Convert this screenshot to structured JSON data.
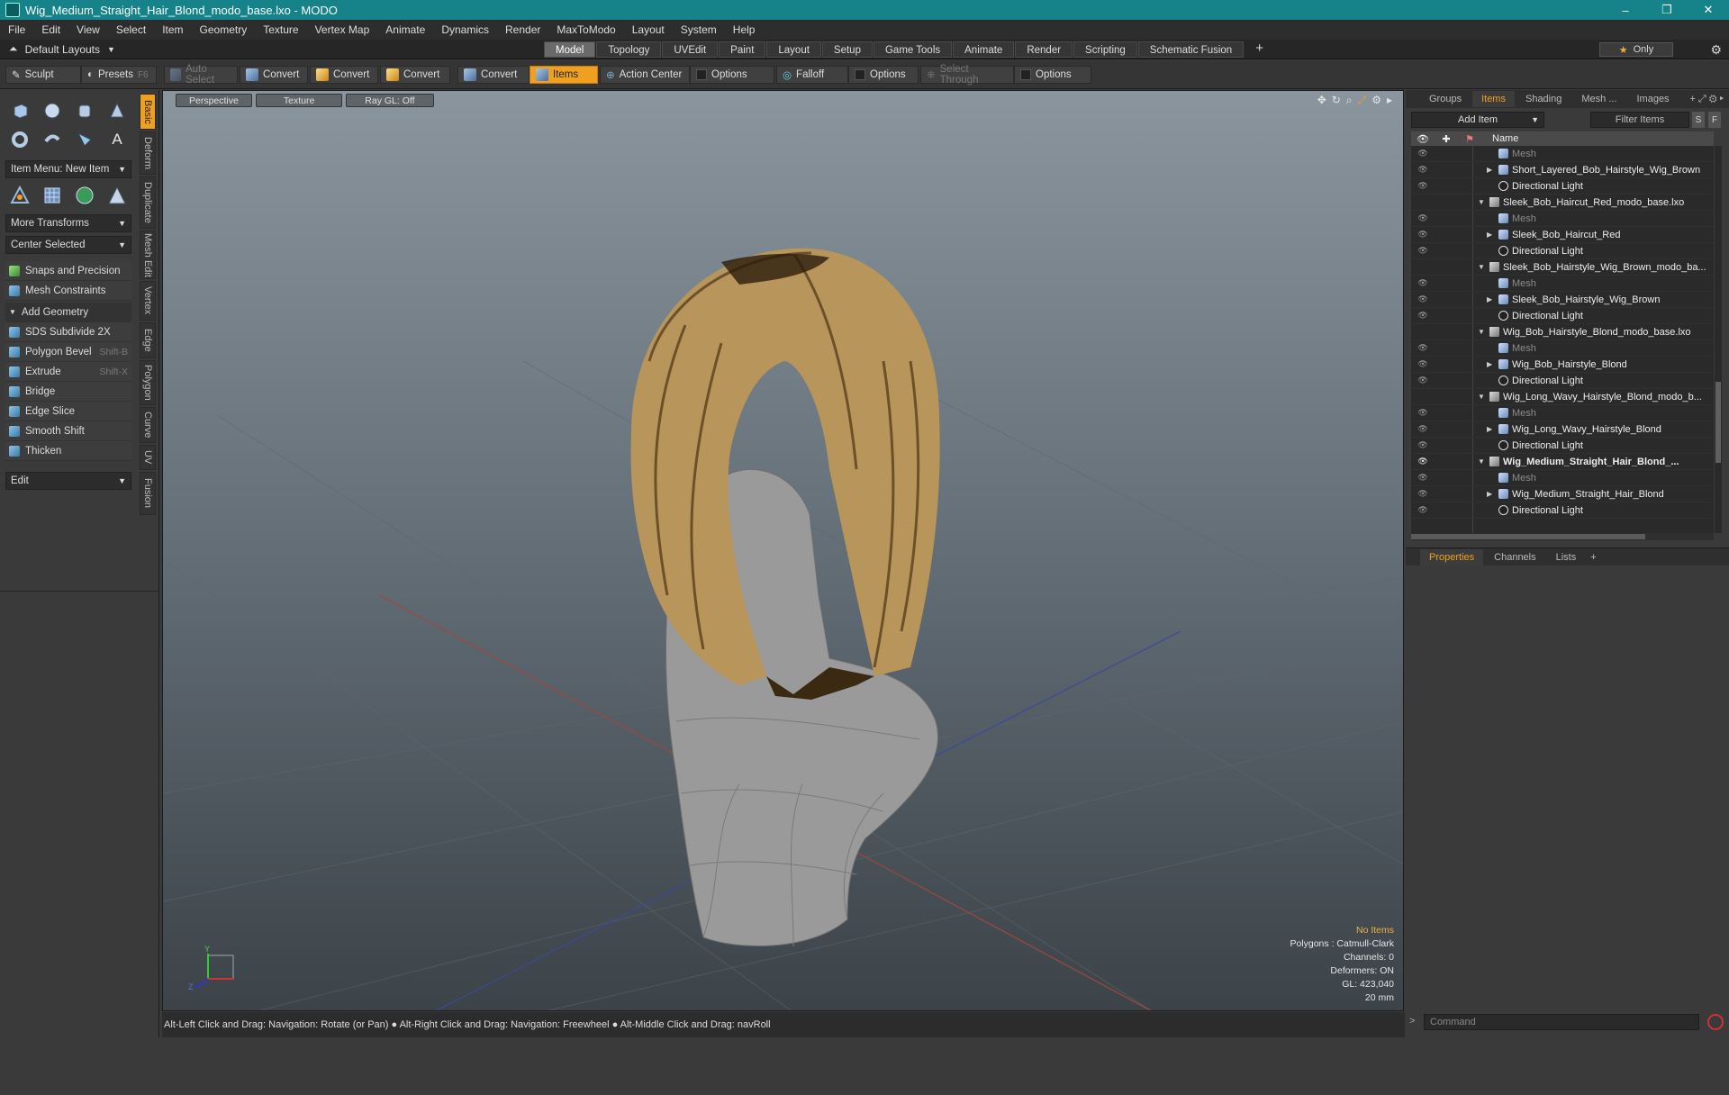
{
  "window": {
    "title": "Wig_Medium_Straight_Hair_Blond_modo_base.lxo - MODO",
    "controls": [
      "–",
      "❐",
      "✕"
    ]
  },
  "menu": [
    "File",
    "Edit",
    "View",
    "Select",
    "Item",
    "Geometry",
    "Texture",
    "Vertex Map",
    "Animate",
    "Dynamics",
    "Render",
    "MaxToModo",
    "Layout",
    "System",
    "Help"
  ],
  "layout": {
    "selector": "Default Layouts",
    "tabs": [
      "Model",
      "Topology",
      "UVEdit",
      "Paint",
      "Layout",
      "Setup",
      "Game Tools",
      "Animate",
      "Render",
      "Scripting",
      "Schematic Fusion"
    ],
    "active_tab": "Model",
    "only_label": "Only"
  },
  "toolbar": {
    "sculpt": "Sculpt",
    "presets": "Presets",
    "presets_key": "F6",
    "auto_select": "Auto Select",
    "convert1": "Convert",
    "convert2": "Convert",
    "convert3": "Convert",
    "convert4": "Convert",
    "items": "Items",
    "action_center": "Action Center",
    "options1": "Options",
    "falloff": "Falloff",
    "options2": "Options",
    "select_through": "Select Through",
    "options3": "Options"
  },
  "left_panel": {
    "item_menu": "Item Menu: New Item",
    "more_transforms": "More Transforms",
    "center_selected": "Center Selected",
    "snaps": "Snaps and Precision",
    "mesh_constraints": "Mesh Constraints",
    "add_geometry": "Add Geometry",
    "tools": [
      {
        "label": "SDS Subdivide 2X",
        "shortcut": ""
      },
      {
        "label": "Polygon Bevel",
        "shortcut": "Shift-B"
      },
      {
        "label": "Extrude",
        "shortcut": "Shift-X"
      },
      {
        "label": "Bridge",
        "shortcut": ""
      },
      {
        "label": "Edge Slice",
        "shortcut": ""
      },
      {
        "label": "Smooth Shift",
        "shortcut": ""
      },
      {
        "label": "Thicken",
        "shortcut": ""
      }
    ],
    "edit_dropdown": "Edit",
    "vertical_tabs": [
      "Basic",
      "Deform",
      "Duplicate",
      "Mesh Edit",
      "Vertex",
      "Edge",
      "Polygon",
      "Curve",
      "UV",
      "Fusion"
    ]
  },
  "viewport": {
    "view": "Perspective",
    "shading": "Texture",
    "raygl": "Ray GL: Off",
    "info": {
      "no_items": "No Items",
      "polygons": "Polygons : Catmull-Clark",
      "channels": "Channels: 0",
      "deformers": "Deformers: ON",
      "gl": "GL: 423,040",
      "scale": "20 mm"
    },
    "axis_labels": {
      "y": "Y",
      "z": "Z"
    }
  },
  "status_bar": "Alt-Left Click and Drag: Navigation: Rotate (or Pan) ● Alt-Right Click and Drag: Navigation: Freewheel ● Alt-Middle Click and Drag: navRoll",
  "items_panel": {
    "tabs": [
      "Groups",
      "Items",
      "Shading",
      "Mesh ...",
      "Images"
    ],
    "active_tab": "Items",
    "add_item": "Add Item",
    "filter": "Filter Items",
    "btn_s": "S",
    "btn_f": "F",
    "column_name": "Name",
    "rows": [
      {
        "label": "Mesh",
        "type": "mesh",
        "indent": 2,
        "tri": "",
        "dim": true,
        "eye": true
      },
      {
        "label": "Short_Layered_Bob_Hairstyle_Wig_Brown",
        "type": "mesh",
        "indent": 2,
        "tri": "▶",
        "dim": false,
        "eye": true
      },
      {
        "label": "Directional Light",
        "type": "light",
        "indent": 2,
        "tri": "",
        "dim": false,
        "eye": true
      },
      {
        "label": "Sleek_Bob_Haircut_Red_modo_base.lxo",
        "type": "group",
        "indent": 1,
        "tri": "▼",
        "dim": false,
        "eye": false
      },
      {
        "label": "Mesh",
        "type": "mesh",
        "indent": 2,
        "tri": "",
        "dim": true,
        "eye": true
      },
      {
        "label": "Sleek_Bob_Haircut_Red",
        "type": "mesh",
        "indent": 2,
        "tri": "▶",
        "dim": false,
        "eye": true
      },
      {
        "label": "Directional Light",
        "type": "light",
        "indent": 2,
        "tri": "",
        "dim": false,
        "eye": true
      },
      {
        "label": "Sleek_Bob_Hairstyle_Wig_Brown_modo_ba...",
        "type": "group",
        "indent": 1,
        "tri": "▼",
        "dim": false,
        "eye": false
      },
      {
        "label": "Mesh",
        "type": "mesh",
        "indent": 2,
        "tri": "",
        "dim": true,
        "eye": true
      },
      {
        "label": "Sleek_Bob_Hairstyle_Wig_Brown",
        "type": "mesh",
        "indent": 2,
        "tri": "▶",
        "dim": false,
        "eye": true
      },
      {
        "label": "Directional Light",
        "type": "light",
        "indent": 2,
        "tri": "",
        "dim": false,
        "eye": true
      },
      {
        "label": "Wig_Bob_Hairstyle_Blond_modo_base.lxo",
        "type": "group",
        "indent": 1,
        "tri": "▼",
        "dim": false,
        "eye": false
      },
      {
        "label": "Mesh",
        "type": "mesh",
        "indent": 2,
        "tri": "",
        "dim": true,
        "eye": true
      },
      {
        "label": "Wig_Bob_Hairstyle_Blond",
        "type": "mesh",
        "indent": 2,
        "tri": "▶",
        "dim": false,
        "eye": true
      },
      {
        "label": "Directional Light",
        "type": "light",
        "indent": 2,
        "tri": "",
        "dim": false,
        "eye": true
      },
      {
        "label": "Wig_Long_Wavy_Hairstyle_Blond_modo_b...",
        "type": "group",
        "indent": 1,
        "tri": "▼",
        "dim": false,
        "eye": false
      },
      {
        "label": "Mesh",
        "type": "mesh",
        "indent": 2,
        "tri": "",
        "dim": true,
        "eye": true
      },
      {
        "label": "Wig_Long_Wavy_Hairstyle_Blond",
        "type": "mesh",
        "indent": 2,
        "tri": "▶",
        "dim": false,
        "eye": true
      },
      {
        "label": "Directional Light",
        "type": "light",
        "indent": 2,
        "tri": "",
        "dim": false,
        "eye": true
      },
      {
        "label": "Wig_Medium_Straight_Hair_Blond_...",
        "type": "group",
        "indent": 1,
        "tri": "▼",
        "dim": false,
        "eye": true,
        "bold": true
      },
      {
        "label": "Mesh",
        "type": "mesh",
        "indent": 2,
        "tri": "",
        "dim": true,
        "eye": true
      },
      {
        "label": "Wig_Medium_Straight_Hair_Blond",
        "type": "mesh",
        "indent": 2,
        "tri": "▶",
        "dim": false,
        "eye": true
      },
      {
        "label": "Directional Light",
        "type": "light",
        "indent": 2,
        "tri": "",
        "dim": false,
        "eye": true
      }
    ]
  },
  "properties_panel": {
    "tabs": [
      "Properties",
      "Channels",
      "Lists"
    ],
    "active_tab": "Properties"
  },
  "command": {
    "placeholder": "Command"
  },
  "colors": {
    "accent": "#f0a020",
    "titlebar": "#16838a",
    "hair": "#b8955a",
    "mannequin": "#9a9a9a"
  }
}
